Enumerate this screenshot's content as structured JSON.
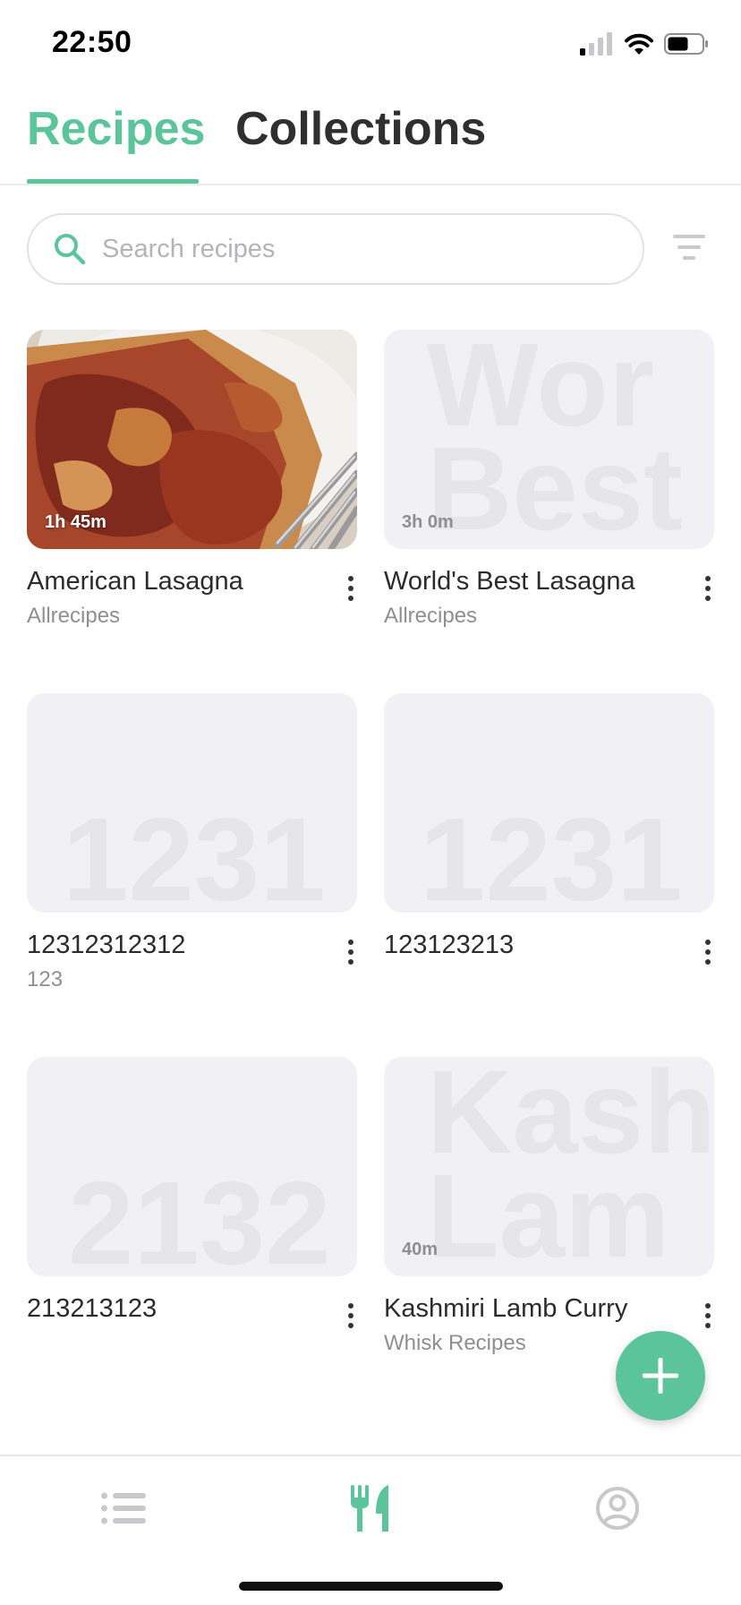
{
  "status_bar": {
    "time": "22:50",
    "icons": [
      "signal-icon",
      "wifi-icon",
      "battery-icon"
    ]
  },
  "tabs": [
    {
      "label": "Recipes",
      "active": true
    },
    {
      "label": "Collections",
      "active": false
    }
  ],
  "search": {
    "placeholder": "Search recipes",
    "value": ""
  },
  "recipes": [
    {
      "title": "American Lasagna",
      "source": "Allrecipes",
      "time": "1h 45m",
      "has_photo": true,
      "ghost_text": ""
    },
    {
      "title": "World's Best Lasagna",
      "source": "Allrecipes",
      "time": "3h 0m",
      "has_photo": false,
      "ghost_text": "Wor\nBest"
    },
    {
      "title": "12312312312",
      "source": "123",
      "time": "",
      "has_photo": false,
      "ghost_text": "1231"
    },
    {
      "title": "123123213",
      "source": "",
      "time": "",
      "has_photo": false,
      "ghost_text": "1231"
    },
    {
      "title": "213213123",
      "source": "",
      "time": "",
      "has_photo": false,
      "ghost_text": "2132"
    },
    {
      "title": "Kashmiri Lamb Curry",
      "source": "Whisk Recipes",
      "time": "40m",
      "has_photo": false,
      "ghost_text": "Kash\nLam"
    }
  ],
  "fab": {
    "icon": "plus-icon"
  },
  "bottom_nav": [
    {
      "icon": "list-icon",
      "active": false
    },
    {
      "icon": "utensils-icon",
      "active": true
    },
    {
      "icon": "profile-icon",
      "active": false
    }
  ],
  "colors": {
    "accent": "#5cc49a",
    "placeholder_bg": "#f1f1f5",
    "muted_text": "#8e8e93",
    "inactive_icon": "#c7c7cc"
  }
}
